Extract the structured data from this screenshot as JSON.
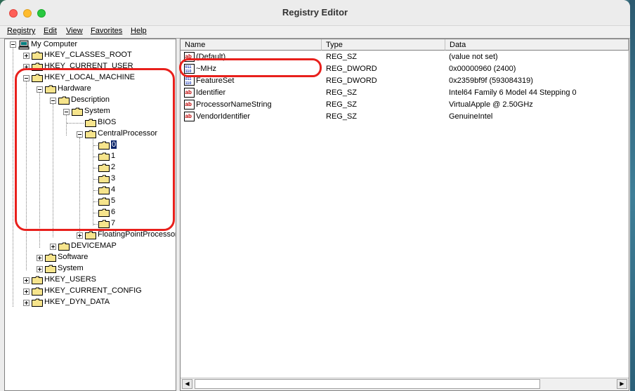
{
  "window": {
    "title": "Registry Editor"
  },
  "menu": [
    "Registry",
    "Edit",
    "View",
    "Favorites",
    "Help"
  ],
  "tree": {
    "root": "My Computer",
    "nodes": [
      "HKEY_CLASSES_ROOT",
      "HKEY_CURRENT_USER",
      "HKEY_LOCAL_MACHINE",
      "Hardware",
      "Description",
      "System",
      "BIOS",
      "CentralProcessor",
      "0",
      "1",
      "2",
      "3",
      "4",
      "5",
      "6",
      "7",
      "FloatingPointProcessor",
      "DEVICEMAP",
      "Software",
      "System",
      "HKEY_USERS",
      "HKEY_CURRENT_CONFIG",
      "HKEY_DYN_DATA"
    ],
    "selected": "0"
  },
  "columns": [
    "Name",
    "Type",
    "Data"
  ],
  "rows": [
    {
      "name": "(Default)",
      "type": "REG_SZ",
      "data": "(value not set)",
      "icon": "string-value-icon"
    },
    {
      "name": "~MHz",
      "type": "REG_DWORD",
      "data": "0x00000960 (2400)",
      "icon": "binary-value-icon"
    },
    {
      "name": "FeatureSet",
      "type": "REG_DWORD",
      "data": "0x2359bf9f (593084319)",
      "icon": "binary-value-icon"
    },
    {
      "name": "Identifier",
      "type": "REG_SZ",
      "data": "Intel64 Family 6 Model 44 Stepping 0",
      "icon": "string-value-icon"
    },
    {
      "name": "ProcessorNameString",
      "type": "REG_SZ",
      "data": "VirtualApple @ 2.50GHz",
      "icon": "string-value-icon"
    },
    {
      "name": "VendorIdentifier",
      "type": "REG_SZ",
      "data": "GenuineIntel",
      "icon": "string-value-icon"
    }
  ],
  "colors": {
    "selection": "#0a246a",
    "annotation": "#e8201c",
    "folder": "#f6e48c"
  }
}
